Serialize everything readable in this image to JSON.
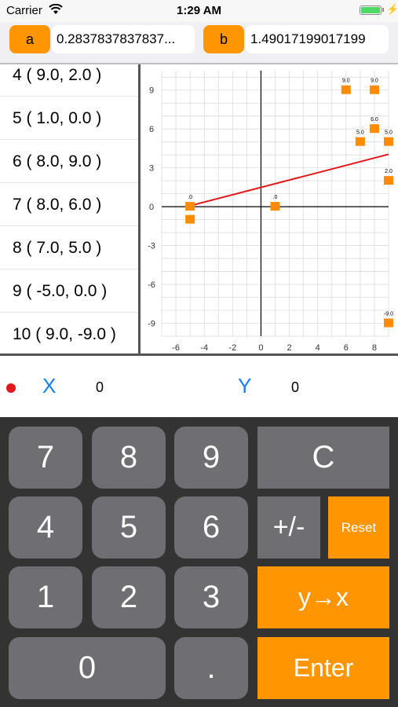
{
  "status_bar": {
    "carrier": "Carrier",
    "time": "1:29 AM",
    "battery": 1.0
  },
  "params": {
    "a_label": "a",
    "a_value": "0.2837837837837...",
    "b_label": "b",
    "b_value": "1.49017199017199"
  },
  "point_list": [
    "4  ( 9.0, 2.0 )",
    "5  ( 1.0, 0.0 )",
    "6  ( 8.0, 9.0 )",
    "7  ( 8.0, 6.0 )",
    "8  ( 7.0, 5.0 )",
    "9  ( -5.0, 0.0 )",
    "10  ( 9.0, -9.0 )"
  ],
  "chart_data": {
    "type": "scatter",
    "x_ticks": [
      -6,
      -4,
      -2,
      0,
      2,
      4,
      6,
      8
    ],
    "y_ticks": [
      9,
      6,
      3,
      0,
      -3,
      -6,
      -9
    ],
    "xlim": [
      -7,
      9
    ],
    "ylim": [
      -10,
      10.5
    ],
    "grid": true,
    "points": [
      {
        "x": -5,
        "y": 0,
        "label": ".0"
      },
      {
        "x": -5,
        "y": -1,
        "label": ""
      },
      {
        "x": 1,
        "y": 0,
        "label": ".0"
      },
      {
        "x": 6,
        "y": 9,
        "label": "9.0"
      },
      {
        "x": 8,
        "y": 9,
        "label": "9.0"
      },
      {
        "x": 8,
        "y": 6,
        "label": "6.0"
      },
      {
        "x": 7,
        "y": 5,
        "label": "5.0"
      },
      {
        "x": 9,
        "y": 5,
        "label": "5.0"
      },
      {
        "x": 9,
        "y": 2,
        "label": "2.0"
      },
      {
        "x": 9,
        "y": -9,
        "label": "-9.0"
      }
    ],
    "regression": {
      "slope": 0.2837837837837,
      "intercept": 1.49017199017199,
      "x_from": -5,
      "x_to": 9
    },
    "point_color": "#ff8c00",
    "line_color": "#e0191c"
  },
  "xy_display": {
    "x_label": "X",
    "x_value": "0",
    "y_label": "Y",
    "y_value": "0"
  },
  "keys": {
    "k7": "7",
    "k8": "8",
    "k9": "9",
    "clear": "C",
    "k4": "4",
    "k5": "5",
    "k6": "6",
    "sign": "+/-",
    "reset": "Reset",
    "k1": "1",
    "k2": "2",
    "k3": "3",
    "swap": "y→x",
    "k0": "0",
    "dot": ".",
    "enter": "Enter"
  },
  "colors": {
    "accent": "#ff9500",
    "blue": "#1a7ef5",
    "key_grey": "#6e6e73",
    "keypad_bg": "#333333"
  }
}
